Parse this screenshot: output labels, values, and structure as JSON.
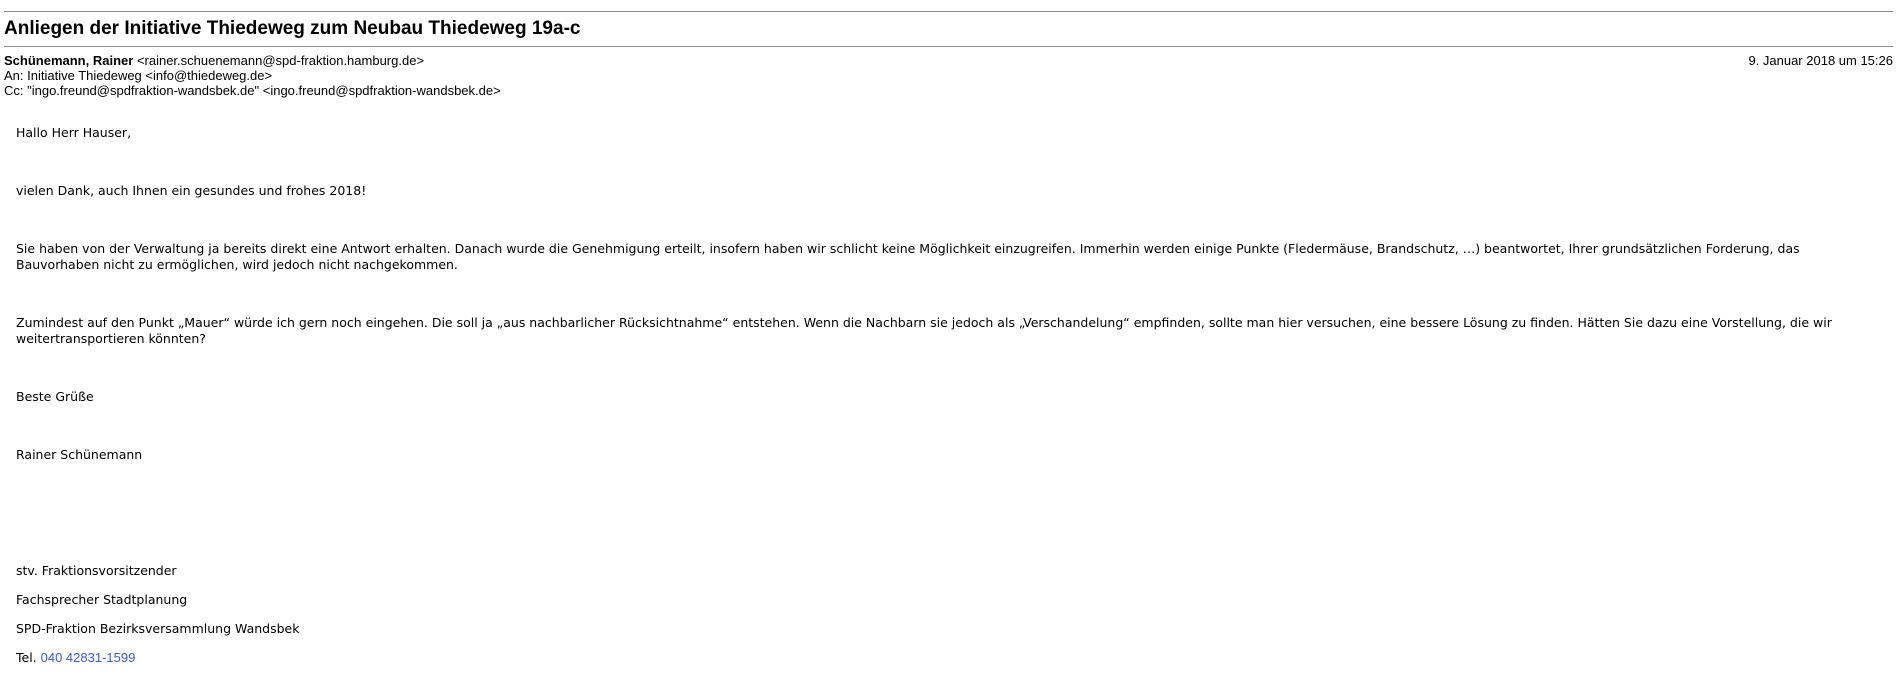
{
  "email": {
    "subject": "Anliegen der Initiative Thiedeweg zum Neubau Thiedeweg 19a-c",
    "from": {
      "name": "Schünemann, Rainer",
      "address": "<rainer.schuenemann@spd-fraktion.hamburg.de>"
    },
    "date": "9. Januar 2018 um 15:26",
    "to": "An: Initiative Thiedeweg <info@thiedeweg.de>",
    "cc": "Cc: \"ingo.freund@spdfraktion-wandsbek.de\" <ingo.freund@spdfraktion-wandsbek.de>"
  },
  "body": {
    "greeting": "Hallo Herr Hauser,",
    "thanks": "vielen Dank, auch Ihnen ein gesundes und frohes 2018!",
    "paragraph1": "Sie haben von der Verwaltung ja bereits direkt eine Antwort erhalten. Danach wurde die Genehmigung erteilt, insofern haben wir schlicht keine Möglichkeit einzugreifen. Immerhin werden einige Punkte (Fledermäuse, Brandschutz, …) beantwortet, Ihrer grundsätzlichen Forderung, das Bauvorhaben nicht zu ermöglichen, wird jedoch nicht nachgekommen.",
    "paragraph2": "Zumindest auf den Punkt „Mauer“ würde ich gern noch eingehen. Die soll ja „aus nachbarlicher Rücksichtnahme“ entstehen. Wenn die Nachbarn sie jedoch als „Verschandelung“ empfinden, sollte man hier versuchen, eine bessere Lösung zu finden. Hätten Sie dazu eine Vorstellung, die wir weitertransportieren könnten?",
    "closing": "Beste Grüße",
    "signature_name": "Rainer Schünemann"
  },
  "signature": {
    "role": "stv. Fraktionsvorsitzender",
    "spokesperson": "Fachsprecher Stadtplanung",
    "organization": "SPD-Fraktion Bezirksversammlung Wandsbek",
    "tel_label": "Tel. ",
    "tel_number": "040 42831-1599"
  },
  "colors": {
    "link": "#3b5bd6",
    "rule": "#8c8c8c"
  }
}
